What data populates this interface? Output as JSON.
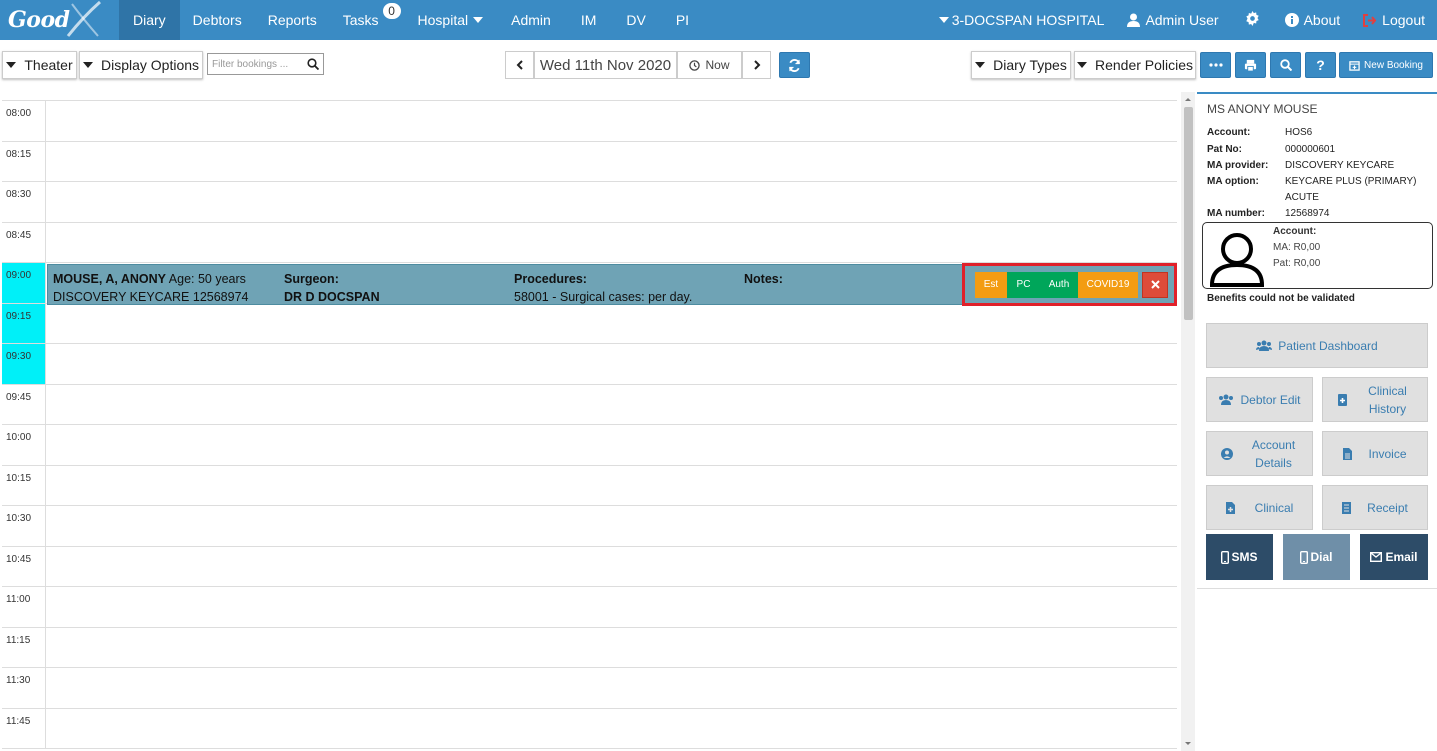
{
  "nav": {
    "logo": "Good",
    "items": [
      {
        "label": "Diary"
      },
      {
        "label": "Debtors"
      },
      {
        "label": "Reports"
      },
      {
        "label": "Tasks",
        "badge": "0"
      },
      {
        "label": "Hospital"
      },
      {
        "label": "Admin"
      },
      {
        "label": "IM"
      },
      {
        "label": "DV"
      },
      {
        "label": "PI"
      }
    ],
    "right": {
      "hospital": "3-DOCSPAN HOSPITAL",
      "user": "Admin User",
      "about": "About",
      "logout": "Logout"
    }
  },
  "toolbar": {
    "theater": "Theater",
    "display_options": "Display Options",
    "filter_placeholder": "Filter bookings ...",
    "date": "Wed 11th Nov 2020",
    "now": "Now",
    "diary_types": "Diary Types",
    "render_policies": "Render Policies",
    "new_booking": "New Booking"
  },
  "slots": [
    "08:00",
    "08:15",
    "08:30",
    "08:45",
    "09:00",
    "09:15",
    "09:30",
    "09:45",
    "10:00",
    "10:15",
    "10:30",
    "10:45",
    "11:00",
    "11:15",
    "11:30",
    "11:45"
  ],
  "booking": {
    "patient": "MOUSE, A, ANONY",
    "age": "Age: 50 years",
    "scheme": "DISCOVERY KEYCARE 12568974",
    "surgeon_label": "Surgeon:",
    "surgeon": "DR D DOCSPAN",
    "procedures_label": "Procedures:",
    "procedure": "58001 - Surgical cases: per day.",
    "notes_label": "Notes:",
    "actions": [
      {
        "label": "Est",
        "color": "#f39c12"
      },
      {
        "label": "PC",
        "color": "#00a65a"
      },
      {
        "label": "Auth",
        "color": "#00a65a"
      },
      {
        "label": "COVID19",
        "color": "#f39c12"
      }
    ]
  },
  "panel": {
    "name": "MS ANONY MOUSE",
    "account_label": "Account:",
    "account": "HOS6",
    "patno_label": "Pat No:",
    "patno": "000000601",
    "provider_label": "MA provider:",
    "provider": "DISCOVERY KEYCARE",
    "option_label": "MA option:",
    "option1": "KEYCARE PLUS (PRIMARY)",
    "option2": "ACUTE",
    "manum_label": "MA number:",
    "manum": "12568974",
    "box_account": "Account:",
    "box_ma": "MA: R0,00",
    "box_pat": "Pat: R0,00",
    "benefits": "Benefits could not be validated",
    "buttons": {
      "dashboard": "Patient Dashboard",
      "debtor_edit": "Debtor Edit",
      "clinical_history": "Clinical History",
      "account_details": "Account Details",
      "invoice": "Invoice",
      "clinical": "Clinical",
      "receipt": "Receipt",
      "sms": "SMS",
      "dial": "Dial",
      "email": "Email"
    }
  }
}
